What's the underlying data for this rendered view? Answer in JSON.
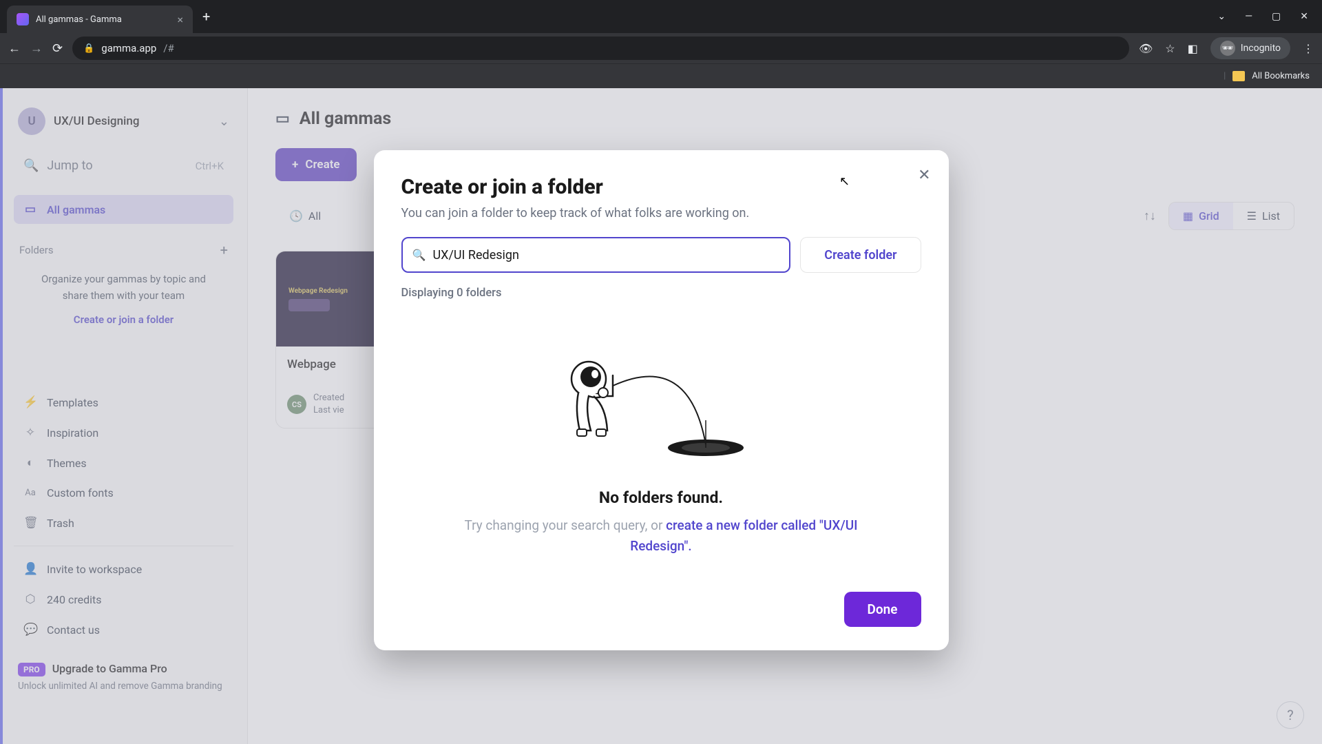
{
  "browser": {
    "tab_title": "All gammas - Gamma",
    "url_domain": "gamma.app",
    "url_path": "/#",
    "incognito_label": "Incognito",
    "bookmarks_label": "All Bookmarks"
  },
  "sidebar": {
    "workspace_initial": "U",
    "workspace_name": "UX/UI Designing",
    "jump_label": "Jump to",
    "jump_shortcut": "Ctrl+K",
    "all_gammas": "All gammas",
    "folders_heading": "Folders",
    "folders_msg": "Organize your gammas by topic and share them with your team",
    "folders_cta": "Create or join a folder",
    "items": [
      {
        "icon": "⚡",
        "label": "Templates"
      },
      {
        "icon": "✧",
        "label": "Inspiration"
      },
      {
        "icon": "◐",
        "label": "Themes"
      },
      {
        "icon": "Aa",
        "label": "Custom fonts"
      },
      {
        "icon": "🗑",
        "label": "Trash"
      }
    ],
    "invite_label": "Invite to workspace",
    "credits_label": "240 credits",
    "contact_label": "Contact us",
    "pro_badge": "PRO",
    "pro_title": "Upgrade to Gamma Pro",
    "pro_sub": "Unlock unlimited AI and remove Gamma branding"
  },
  "main": {
    "title": "All gammas",
    "create_btn": "Create",
    "tab_all": "All",
    "view_grid": "Grid",
    "view_list": "List",
    "card_title": "Webpage",
    "card_created": "Created",
    "card_lastview": "Last vie",
    "card_av": "CS"
  },
  "dialog": {
    "title": "Create or join a folder",
    "subtitle": "You can join a folder to keep track of what folks are working on.",
    "search_value": "UX/UI Redesign",
    "create_btn": "Create folder",
    "displaying": "Displaying 0 folders",
    "empty_title": "No folders found.",
    "empty_prefix": "Try changing your search query, or ",
    "empty_link": "create a new folder called \"UX/UI Redesign\".",
    "done": "Done"
  }
}
